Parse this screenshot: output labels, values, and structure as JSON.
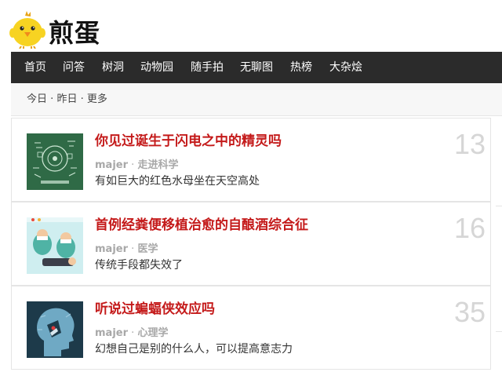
{
  "site": {
    "logo_text": "煎蛋",
    "logo_icon": "chick-icon"
  },
  "nav": {
    "items": [
      {
        "label": "首页"
      },
      {
        "label": "问答"
      },
      {
        "label": "树洞"
      },
      {
        "label": "动物园"
      },
      {
        "label": "随手拍"
      },
      {
        "label": "无聊图"
      },
      {
        "label": "热榜"
      },
      {
        "label": "大杂烩"
      }
    ]
  },
  "subnav": {
    "today": "今日",
    "yesterday": "昨日",
    "more": "更多",
    "separator": "·"
  },
  "posts": [
    {
      "title": "你见过诞生于闪电之中的精灵吗",
      "author": "majer",
      "separator": "·",
      "category": "走进科学",
      "excerpt": "有如巨大的红色水母坐在天空高处",
      "count": "13",
      "thumb_icon": "science-chalkboard-thumbnail"
    },
    {
      "title": "首例经粪便移植治愈的自酿酒综合征",
      "author": "majer",
      "separator": "·",
      "category": "医学",
      "excerpt": "传统手段都失效了",
      "count": "16",
      "thumb_icon": "doctors-illustration-thumbnail"
    },
    {
      "title": "听说过蝙蝠侠效应吗",
      "author": "majer",
      "separator": "·",
      "category": "心理学",
      "excerpt": "幻想自己是别的什么人，可以提高意志力",
      "count": "35",
      "thumb_icon": "head-silhouette-thumbnail"
    }
  ],
  "colors": {
    "nav_bg": "#2b2b2b",
    "title_red": "#c41a1a",
    "chick_yellow": "#f7d322",
    "count_gray": "#d6d6d6"
  }
}
